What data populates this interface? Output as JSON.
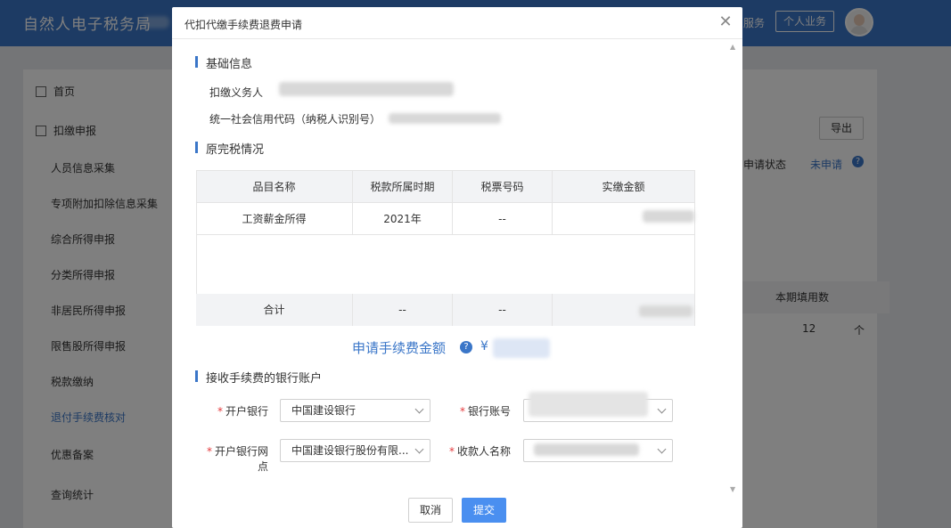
{
  "app": {
    "brand": "自然人电子税务局",
    "top_service": "服务",
    "top_personal": "个人业务"
  },
  "sidebar": {
    "items": [
      {
        "label": "首页",
        "icon": "home-icon"
      },
      {
        "label": "扣缴申报",
        "icon": "report-icon"
      },
      {
        "label": "人员信息采集"
      },
      {
        "label": "专项附加扣除信息采集"
      },
      {
        "label": "综合所得申报"
      },
      {
        "label": "分类所得申报"
      },
      {
        "label": "非居民所得申报"
      },
      {
        "label": "限售股所得申报"
      },
      {
        "label": "税款缴纳"
      },
      {
        "label": "退付手续费核对"
      },
      {
        "label": "优惠备案"
      },
      {
        "label": "查询统计"
      }
    ],
    "active_index": 9
  },
  "background": {
    "export_label": "导出",
    "status_label": "申请状态",
    "status_value": "未申请",
    "col_header": "本期填用数",
    "cell_value": "12",
    "cell_unit": "个"
  },
  "modal": {
    "title": "代扣代缴手续费退费申请",
    "section_basic": "基础信息",
    "withholder_label": "扣缴义务人",
    "credit_code_label": "统一社会信用代码（纳税人识别号）",
    "section_tax": "原完税情况",
    "table": {
      "headers": [
        "品目名称",
        "税款所属时期",
        "税票号码",
        "实缴金额"
      ],
      "rows": [
        {
          "item": "工资薪金所得",
          "period": "2021年",
          "ticket": "--"
        }
      ],
      "total": {
        "item": "合计",
        "period": "--",
        "ticket": "--"
      }
    },
    "fee_label": "申请手续费金额",
    "fee_currency": "¥",
    "section_bank": "接收手续费的银行账户",
    "form": {
      "bank_label": "开户银行",
      "bank_value": "中国建设银行",
      "account_label": "银行账号",
      "branch_label": "开户银行网点",
      "branch_value": "中国建设银行股份有限...",
      "payee_label": "收款人名称"
    },
    "cancel_label": "取消",
    "submit_label": "提交"
  }
}
